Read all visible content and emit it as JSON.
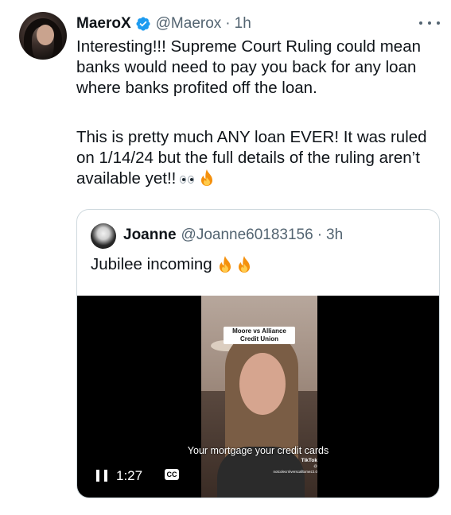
{
  "tweet": {
    "display_name": "MaeroX",
    "handle": "@Maerox",
    "separator": "·",
    "time": "1h",
    "paragraph1": "Interesting!!! Supreme Court Ruling could mean banks would need to pay you back for any loan where banks profited off the loan.",
    "paragraph2": "This is pretty much ANY loan EVER! It was ruled on 1/14/24 but the full details of the ruling aren’t available yet!!",
    "emojis": [
      "eyes-emoji",
      "fire-emoji"
    ]
  },
  "quoted_tweet": {
    "display_name": "Joanne",
    "handle": "@Joanne60183156",
    "separator": "·",
    "time": "3h",
    "text": "Jubilee incoming",
    "emojis": [
      "fire-emoji",
      "fire-emoji"
    ]
  },
  "video": {
    "overlay_label": "Moore vs Alliance Credit Union",
    "caption": "Your mortgage your credit cards",
    "watermark_brand": "TikTok",
    "watermark_user": "@ notcolecrnlverscalltomez2.0",
    "duration": "1:27",
    "cc_label": "CC",
    "state": "playing"
  },
  "colors": {
    "verified_blue": "#1d9bf0",
    "secondary_text": "#536471",
    "border": "#cfd9de",
    "fire_outer": "#f4900c",
    "fire_inner": "#ffcc4d"
  }
}
